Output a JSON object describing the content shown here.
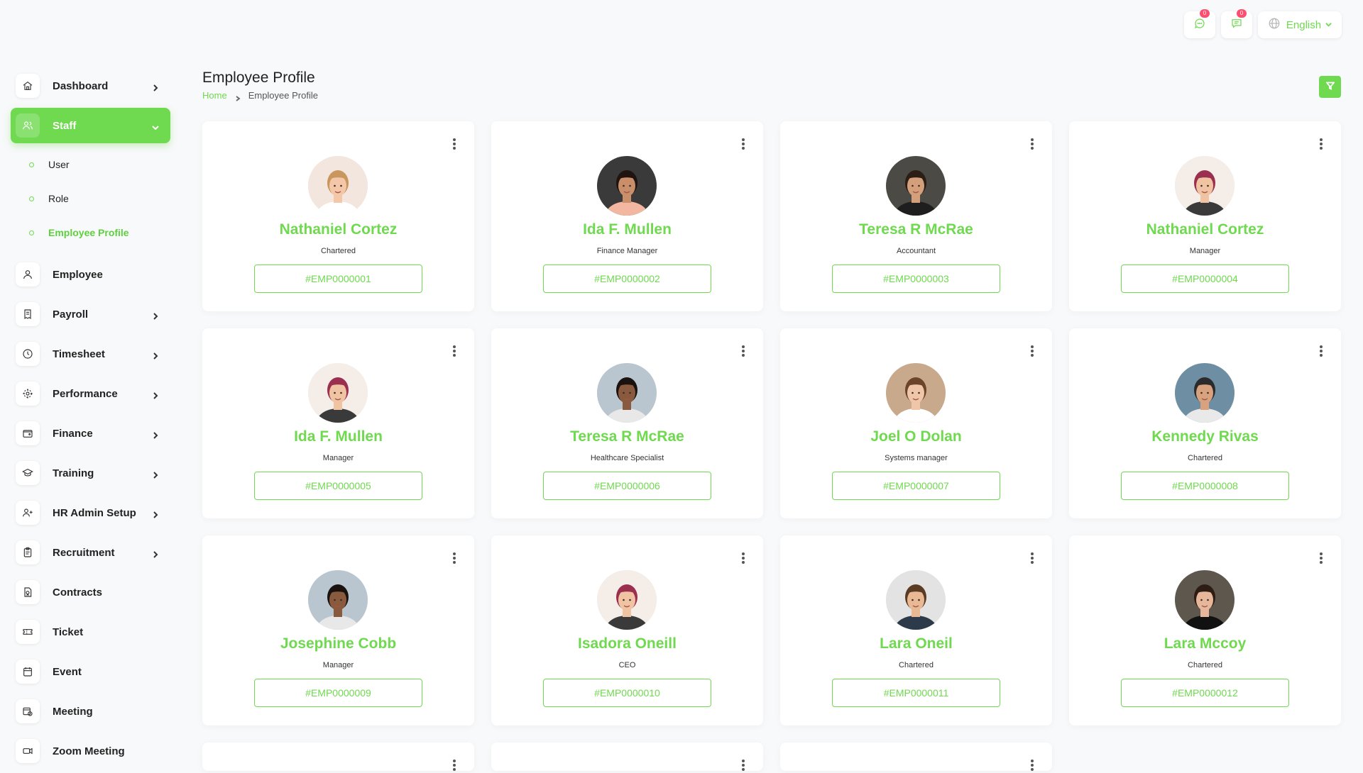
{
  "sidebar": {
    "items": [
      {
        "label": "Dashboard",
        "icon": "home-icon",
        "chevron": "right"
      },
      {
        "label": "Staff",
        "icon": "users-icon",
        "chevron": "down",
        "active": true,
        "children": [
          {
            "label": "User"
          },
          {
            "label": "Role"
          },
          {
            "label": "Employee Profile",
            "current": true
          }
        ]
      },
      {
        "label": "Employee",
        "icon": "user-icon",
        "chevron": ""
      },
      {
        "label": "Payroll",
        "icon": "receipt-icon",
        "chevron": "right"
      },
      {
        "label": "Timesheet",
        "icon": "clock-icon",
        "chevron": "right"
      },
      {
        "label": "Performance",
        "icon": "target-icon",
        "chevron": "right"
      },
      {
        "label": "Finance",
        "icon": "wallet-icon",
        "chevron": "right"
      },
      {
        "label": "Training",
        "icon": "graduation-cap-icon",
        "chevron": "right"
      },
      {
        "label": "HR Admin Setup",
        "icon": "user-plus-icon",
        "chevron": "right"
      },
      {
        "label": "Recruitment",
        "icon": "clipboard-icon",
        "chevron": "right"
      },
      {
        "label": "Contracts",
        "icon": "contract-icon",
        "chevron": ""
      },
      {
        "label": "Ticket",
        "icon": "ticket-icon",
        "chevron": ""
      },
      {
        "label": "Event",
        "icon": "calendar-icon",
        "chevron": ""
      },
      {
        "label": "Meeting",
        "icon": "calendar-clock-icon",
        "chevron": ""
      },
      {
        "label": "Zoom Meeting",
        "icon": "video-icon",
        "chevron": ""
      }
    ]
  },
  "topbar": {
    "messages_count": "0",
    "chat_count": "0",
    "language": "English"
  },
  "page": {
    "title": "Employee Profile",
    "breadcrumb_home": "Home",
    "breadcrumb_current": "Employee Profile"
  },
  "employees": [
    {
      "name": "Nathaniel Cortez",
      "role": "Chartered",
      "id": "#EMP0000001",
      "avatar": {
        "bg": "#f2e6de",
        "skin": "#f3c7a8",
        "hair": "#c9965e",
        "shirt": "#ffffff"
      }
    },
    {
      "name": "Ida F. Mullen",
      "role": "Finance Manager",
      "id": "#EMP0000002",
      "avatar": {
        "bg": "#3a3a3a",
        "skin": "#c98e6a",
        "hair": "#1f1410",
        "shirt": "#f3b7a1"
      }
    },
    {
      "name": "Teresa R McRae",
      "role": "Accountant",
      "id": "#EMP0000003",
      "avatar": {
        "bg": "#4b4a44",
        "skin": "#d4a07c",
        "hair": "#2a1e17",
        "shirt": "#1e1e1e"
      }
    },
    {
      "name": "Nathaniel Cortez",
      "role": "Manager",
      "id": "#EMP0000004",
      "avatar": {
        "bg": "#f4ede8",
        "skin": "#f0c3a3",
        "hair": "#9b2f4f",
        "shirt": "#3a3a3a"
      }
    },
    {
      "name": "Ida F. Mullen",
      "role": "Manager",
      "id": "#EMP0000005",
      "avatar": {
        "bg": "#f4ede8",
        "skin": "#f0c3a3",
        "hair": "#9b2f4f",
        "shirt": "#3a3a3a"
      }
    },
    {
      "name": "Teresa R McRae",
      "role": "Healthcare Specialist",
      "id": "#EMP0000006",
      "avatar": {
        "bg": "#b9c6cf",
        "skin": "#8a5a3e",
        "hair": "#1a120e",
        "shirt": "#e8e8e8"
      }
    },
    {
      "name": "Joel O Dolan",
      "role": "Systems manager",
      "id": "#EMP0000007",
      "avatar": {
        "bg": "#c9a98c",
        "skin": "#f0c6a8",
        "hair": "#6b4429",
        "shirt": "#ffffff"
      }
    },
    {
      "name": "Kennedy Rivas",
      "role": "Chartered",
      "id": "#EMP0000008",
      "avatar": {
        "bg": "#6d8ea3",
        "skin": "#d9a27e",
        "hair": "#2b2b2b",
        "shirt": "#e9e9e9"
      }
    },
    {
      "name": "Josephine Cobb",
      "role": "Manager",
      "id": "#EMP0000009",
      "avatar": {
        "bg": "#b9c6cf",
        "skin": "#8a5a3e",
        "hair": "#1a120e",
        "shirt": "#e8e8e8"
      }
    },
    {
      "name": "Isadora Oneill",
      "role": "CEO",
      "id": "#EMP0000010",
      "avatar": {
        "bg": "#f4ede8",
        "skin": "#f0c3a3",
        "hair": "#9b2f4f",
        "shirt": "#3a3a3a"
      }
    },
    {
      "name": "Lara Oneil",
      "role": "Chartered",
      "id": "#EMP0000011",
      "avatar": {
        "bg": "#e3e3e3",
        "skin": "#e9b894",
        "hair": "#5a3b24",
        "shirt": "#2d3a4a"
      }
    },
    {
      "name": "Lara Mccoy",
      "role": "Chartered",
      "id": "#EMP0000012",
      "avatar": {
        "bg": "#5e574d",
        "skin": "#e6b79a",
        "hair": "#2d1d15",
        "shirt": "#111111"
      }
    }
  ],
  "partial_cards": 3,
  "colors": {
    "accent": "#6fd94f",
    "badge": "#ff4d6d",
    "background": "#f8f9fa"
  }
}
